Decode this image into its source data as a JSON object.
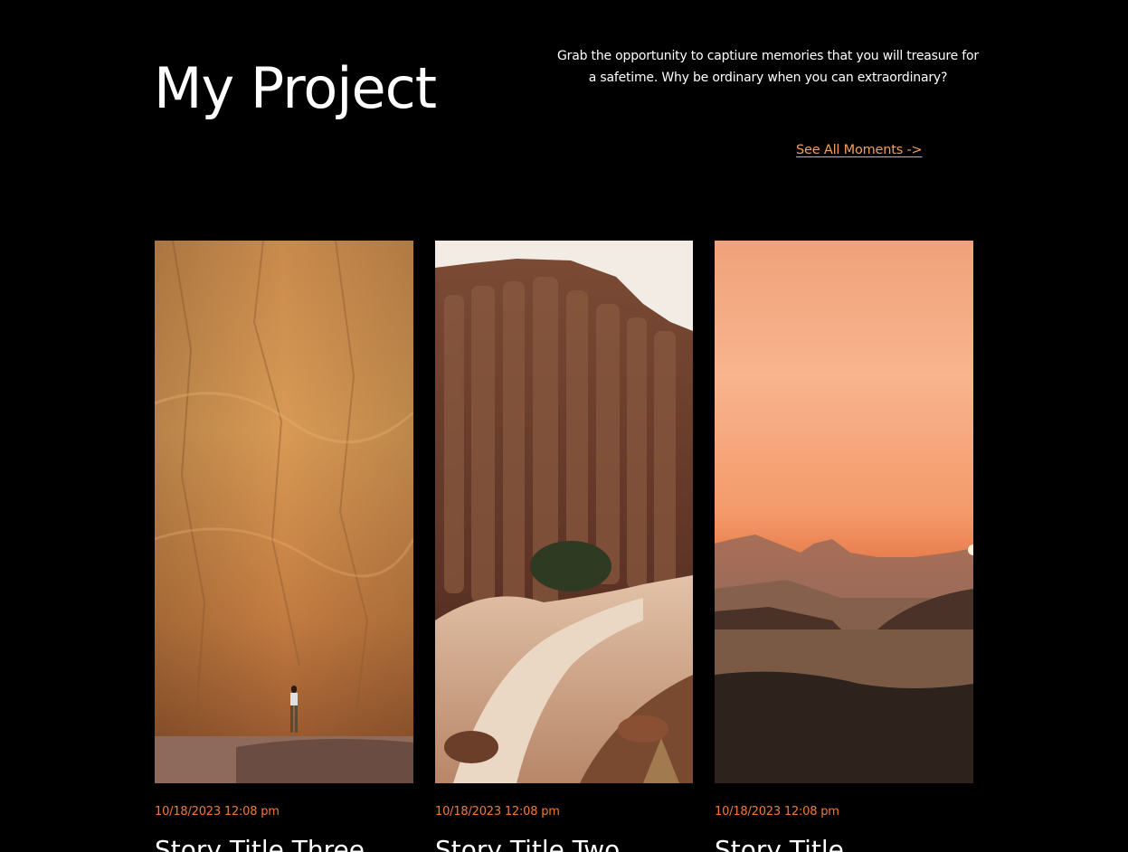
{
  "header": {
    "title": "My Project",
    "tagline": "Grab the opportunity to captiure memories that you will treasure for a safetime. Why be ordinary when you can extraordinary?",
    "see_all_link": "See All Moments ->"
  },
  "colors": {
    "background": "#000000",
    "accent": "#f4a05c",
    "date": "#f07a3a",
    "text": "#ffffff"
  },
  "stories": [
    {
      "date": "10/18/2023 12:08 pm",
      "title": "Story Title Three",
      "image": "canyon-wall-with-hiker"
    },
    {
      "date": "10/18/2023 12:08 pm",
      "title": "Story Title Two",
      "image": "desert-rock-formations"
    },
    {
      "date": "10/18/2023 12:08 pm",
      "title": "Story Title",
      "image": "desert-sunset"
    }
  ]
}
